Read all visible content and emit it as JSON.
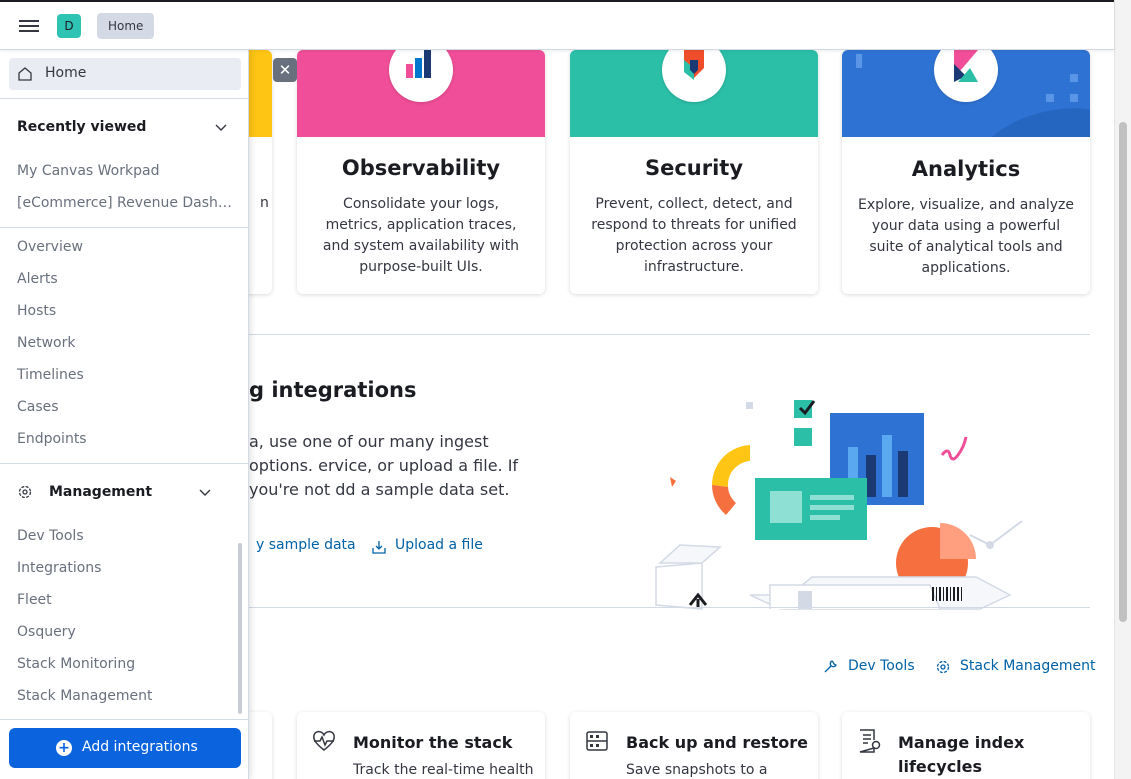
{
  "header": {
    "space_initial": "D",
    "breadcrumb": "Home"
  },
  "sidenav": {
    "home_label": "Home",
    "recently_viewed": {
      "title": "Recently viewed",
      "items": [
        "My Canvas Workpad",
        "[eCommerce] Revenue Dashboard"
      ]
    },
    "security_items": [
      "Overview",
      "Alerts",
      "Hosts",
      "Network",
      "Timelines",
      "Cases",
      "Endpoints"
    ],
    "management": {
      "title": "Management",
      "items": [
        "Dev Tools",
        "Integrations",
        "Fleet",
        "Osquery",
        "Stack Monitoring",
        "Stack Management"
      ]
    },
    "add_button": "Add integrations"
  },
  "solutions": [
    {
      "title": "Observability",
      "description": "Consolidate your logs, metrics, application traces, and system availability with purpose-built UIs.",
      "color": "#f04e98"
    },
    {
      "title": "Security",
      "description": "Prevent, collect, detect, and respond to threats for unified protection across your infrastructure.",
      "color": "#2bbfa8"
    },
    {
      "title": "Analytics",
      "description": "Explore, visualize, and analyze your data using a powerful suite of analytical tools and applications.",
      "color": "#2e73d4"
    }
  ],
  "partial_card_text": "n",
  "ingest": {
    "title": "g integrations",
    "description": "a, use one of our many ingest options. ervice, or upload a file. If you're not dd a sample data set.",
    "sample_link": "y sample data",
    "upload_link": "Upload a file"
  },
  "management_links": {
    "dev_tools": "Dev Tools",
    "stack_management": "Stack Management"
  },
  "manage_cards": [
    {
      "title": "Monitor the stack",
      "description": "Track the real-time health"
    },
    {
      "title": "Back up and restore",
      "description": "Save snapshots to a"
    },
    {
      "title": "Manage index lifecycles",
      "description": ""
    }
  ],
  "colors": {
    "accent": "#0b64dd",
    "link": "#0061a6",
    "yellow_band": "#fec514"
  }
}
